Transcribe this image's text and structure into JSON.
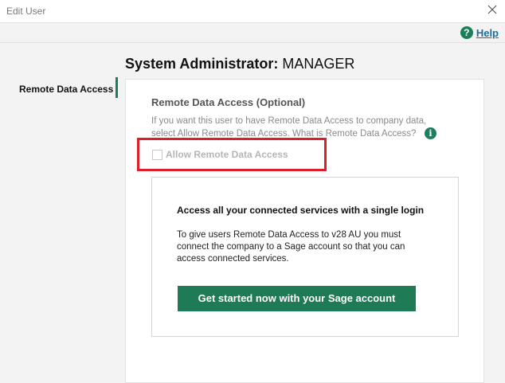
{
  "window": {
    "title": "Edit User"
  },
  "help": {
    "label": "Help",
    "icon": "question-circle-icon"
  },
  "header": {
    "role": "System Administrator:",
    "user": "MANAGER"
  },
  "sidebar": {
    "items": [
      {
        "label": "Remote Data Access",
        "active": true
      }
    ]
  },
  "section": {
    "title": "Remote Data Access (Optional)",
    "description": "If you want this user to have Remote Data Access to company data, select Allow Remote Data Access. What is Remote Data Access?",
    "checkbox_label": "Allow Remote Data Access",
    "checkbox_checked": false,
    "checkbox_enabled": false
  },
  "card": {
    "heading": "Access all your connected services with a single login",
    "body": "To give users Remote Data Access to v28 AU you must connect the company to a Sage account so that you can access connected services.",
    "button_label": "Get started now with your Sage account"
  },
  "colors": {
    "accent": "#1a7f5a",
    "button": "#1f7a56",
    "highlight": "#dd1f2b",
    "link": "#1a6e9e"
  }
}
